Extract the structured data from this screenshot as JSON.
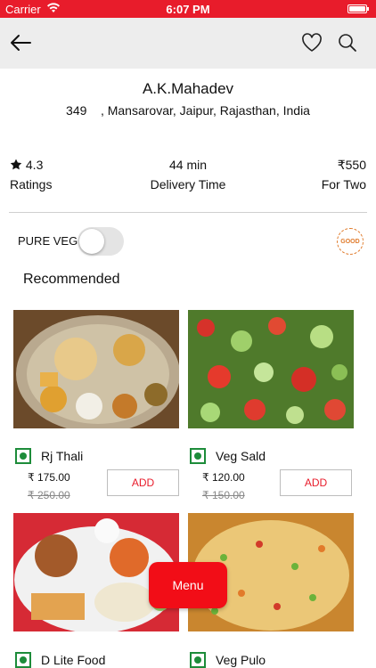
{
  "status_bar": {
    "carrier": "Carrier",
    "time": "6:07 PM"
  },
  "navbar": {
    "back_icon": "arrow-left-icon",
    "favorite_icon": "heart-icon",
    "search_icon": "search-icon"
  },
  "restaurant": {
    "name": "A.K.Mahadev",
    "address": "349    , Mansarovar, Jaipur, Rajasthan, India"
  },
  "stats": {
    "rating_value": "4.3",
    "rating_label": "Ratings",
    "delivery_value": "44 min",
    "delivery_label": "Delivery Time",
    "cost_value": "₹550",
    "cost_label": "For Two"
  },
  "filters": {
    "pure_veg_label": "PURE VEG",
    "pure_veg_on": false,
    "hygiene_badge_text": "GOOD"
  },
  "section_title": "Recommended",
  "dishes": [
    {
      "name": "Rj Thali",
      "price": "₹ 175.00",
      "old_price": "₹ 250.00",
      "add_label": "ADD",
      "veg": true
    },
    {
      "name": "Veg Sald",
      "price": "₹ 120.00",
      "old_price": "₹ 150.00",
      "add_label": "ADD",
      "veg": true
    },
    {
      "name": "D Lite Food",
      "veg": true
    },
    {
      "name": "Veg Pulo",
      "veg": true
    }
  ],
  "menu_button": "Menu",
  "colors": {
    "brand": "#e81c2b",
    "veg": "#1d8c3a"
  }
}
